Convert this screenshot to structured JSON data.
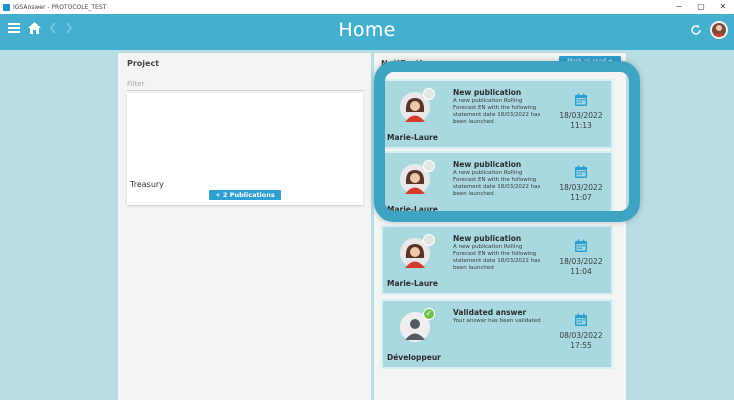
{
  "window": {
    "title": "IGSAnswer - PROTOCOLE_TEST",
    "controls": [
      "−",
      "▢",
      "✕"
    ]
  },
  "header": {
    "title": "Home",
    "menu_icon": "hamburger-icon",
    "home_icon": "home-icon",
    "back_icon": "chevron-left-icon",
    "forward_icon": "chevron-right-icon",
    "refresh_icon": "refresh-icon",
    "color": "#45afce"
  },
  "project": {
    "heading": "Project",
    "filter_placeholder": "Filter",
    "cards": [
      {
        "name": "Treasury",
        "button": "+ 2 Publications"
      }
    ]
  },
  "notifications": {
    "heading": "Notifications",
    "mark_read": "Mark as read +",
    "items": [
      {
        "author": "Marie-Laure",
        "title": "New publication",
        "body": "A new publication Rolling Forecast EN with the following statement date 18/03/2022 has been launched",
        "date": "18/03/2022",
        "time": "11:13"
      },
      {
        "author": "Marie-Laure",
        "title": "New publication",
        "body": "A new publication Rolling Forecast EN with the following statement date 18/03/2022 has been launched",
        "date": "18/03/2022",
        "time": "11:07"
      },
      {
        "author": "Marie-Laure",
        "title": "New publication",
        "body": "A new publication Rolling Forecast EN with the following statement date 18/03/2022 has been launched",
        "date": "18/03/2022",
        "time": "11:04"
      },
      {
        "author": "Développeur",
        "title": "Validated answer",
        "body": "Your answer has been validated",
        "date": "08/03/2022",
        "time": "17:55"
      }
    ]
  }
}
